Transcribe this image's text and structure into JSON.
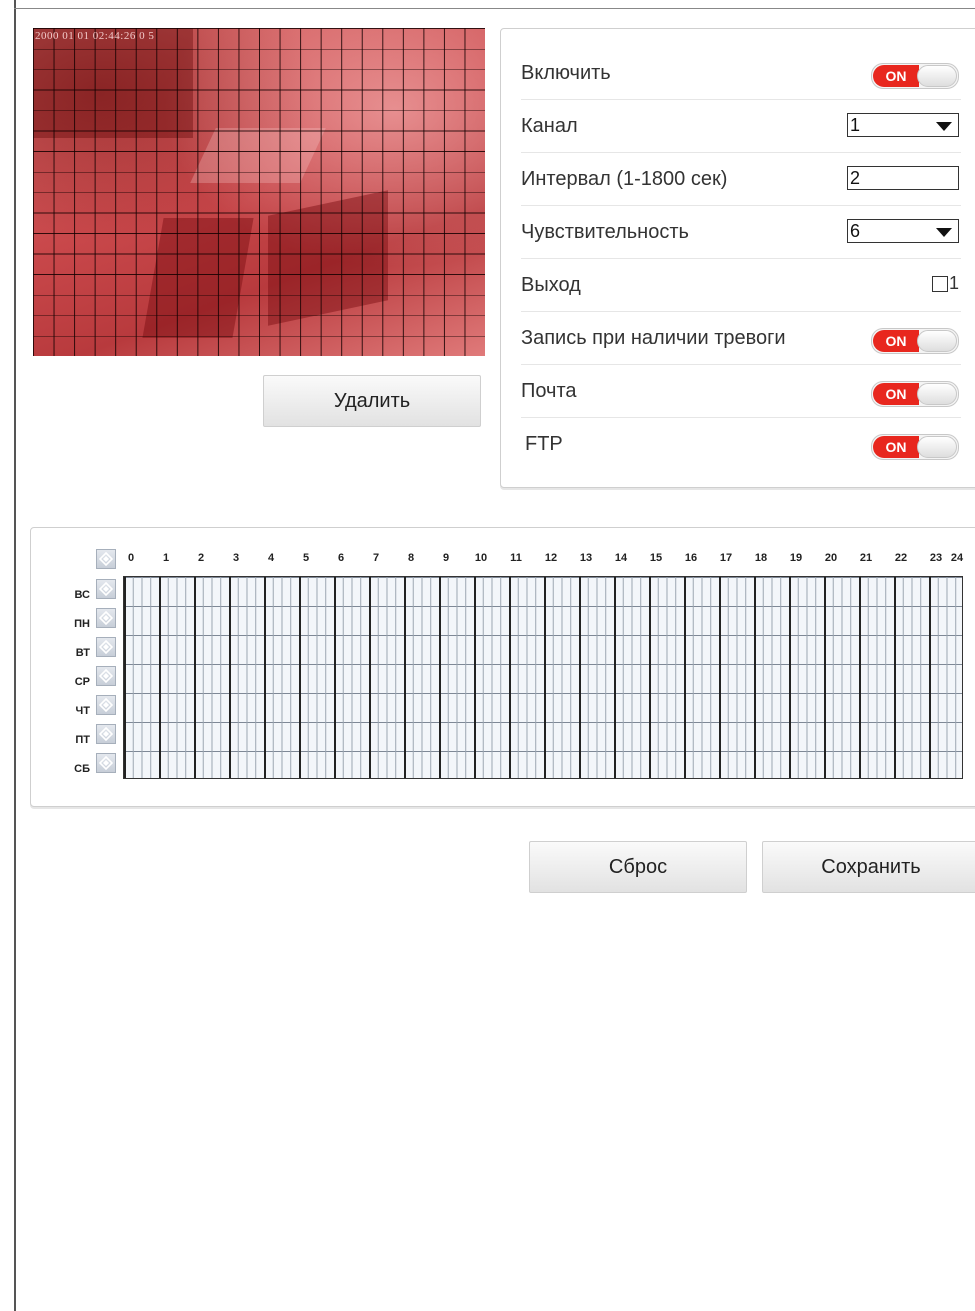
{
  "preview": {
    "timestamp": "2000 01 01 02:44:26 0 5"
  },
  "delete_button": {
    "label": "Удалить"
  },
  "settings": {
    "enable": {
      "label": "Включить",
      "state": "ON"
    },
    "channel": {
      "label": "Канал",
      "value": "1"
    },
    "interval": {
      "label": "Интервал (1-1800 сек)",
      "value": "2"
    },
    "sensitivity": {
      "label": "Чувствительность",
      "value": "6"
    },
    "output": {
      "label": "Выход",
      "option": "1",
      "checked": false
    },
    "alarm_record": {
      "label": "Запись при наличии тревоги",
      "state": "ON"
    },
    "mail": {
      "label": "Почта",
      "state": "ON"
    },
    "ftp": {
      "label": "FTP",
      "state": "ON"
    }
  },
  "schedule": {
    "hours": [
      "0",
      "1",
      "2",
      "3",
      "4",
      "5",
      "6",
      "7",
      "8",
      "9",
      "10",
      "11",
      "12",
      "13",
      "14",
      "15",
      "16",
      "17",
      "18",
      "19",
      "20",
      "21",
      "22",
      "23",
      "24"
    ],
    "days": [
      "ВС",
      "ПН",
      "ВТ",
      "СР",
      "ЧТ",
      "ПТ",
      "СБ"
    ],
    "icon": "select-all-icon"
  },
  "footer": {
    "reset_label": "Сброс",
    "save_label": "Сохранить"
  },
  "colors": {
    "toggle_on": "#e8271e",
    "preview_mask": "#c9484b"
  }
}
